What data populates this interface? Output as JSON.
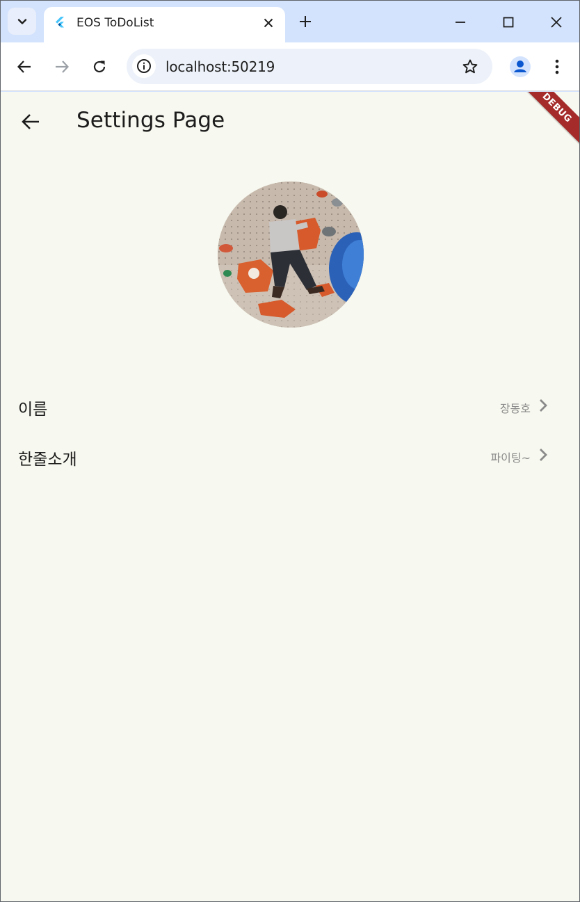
{
  "browser": {
    "tab_title": "EOS ToDoList",
    "url": "localhost:50219"
  },
  "appbar": {
    "title": "Settings Page"
  },
  "debug_banner": "DEBUG",
  "settings": [
    {
      "label": "이름",
      "value": "장동호"
    },
    {
      "label": "한줄소개",
      "value": "파이팅~"
    }
  ],
  "colors": {
    "tabstrip": "#d3e3fd",
    "app_background": "#f7f8ef",
    "debug_banner": "#a52a2a",
    "profile_accent": "#0b57d0"
  }
}
